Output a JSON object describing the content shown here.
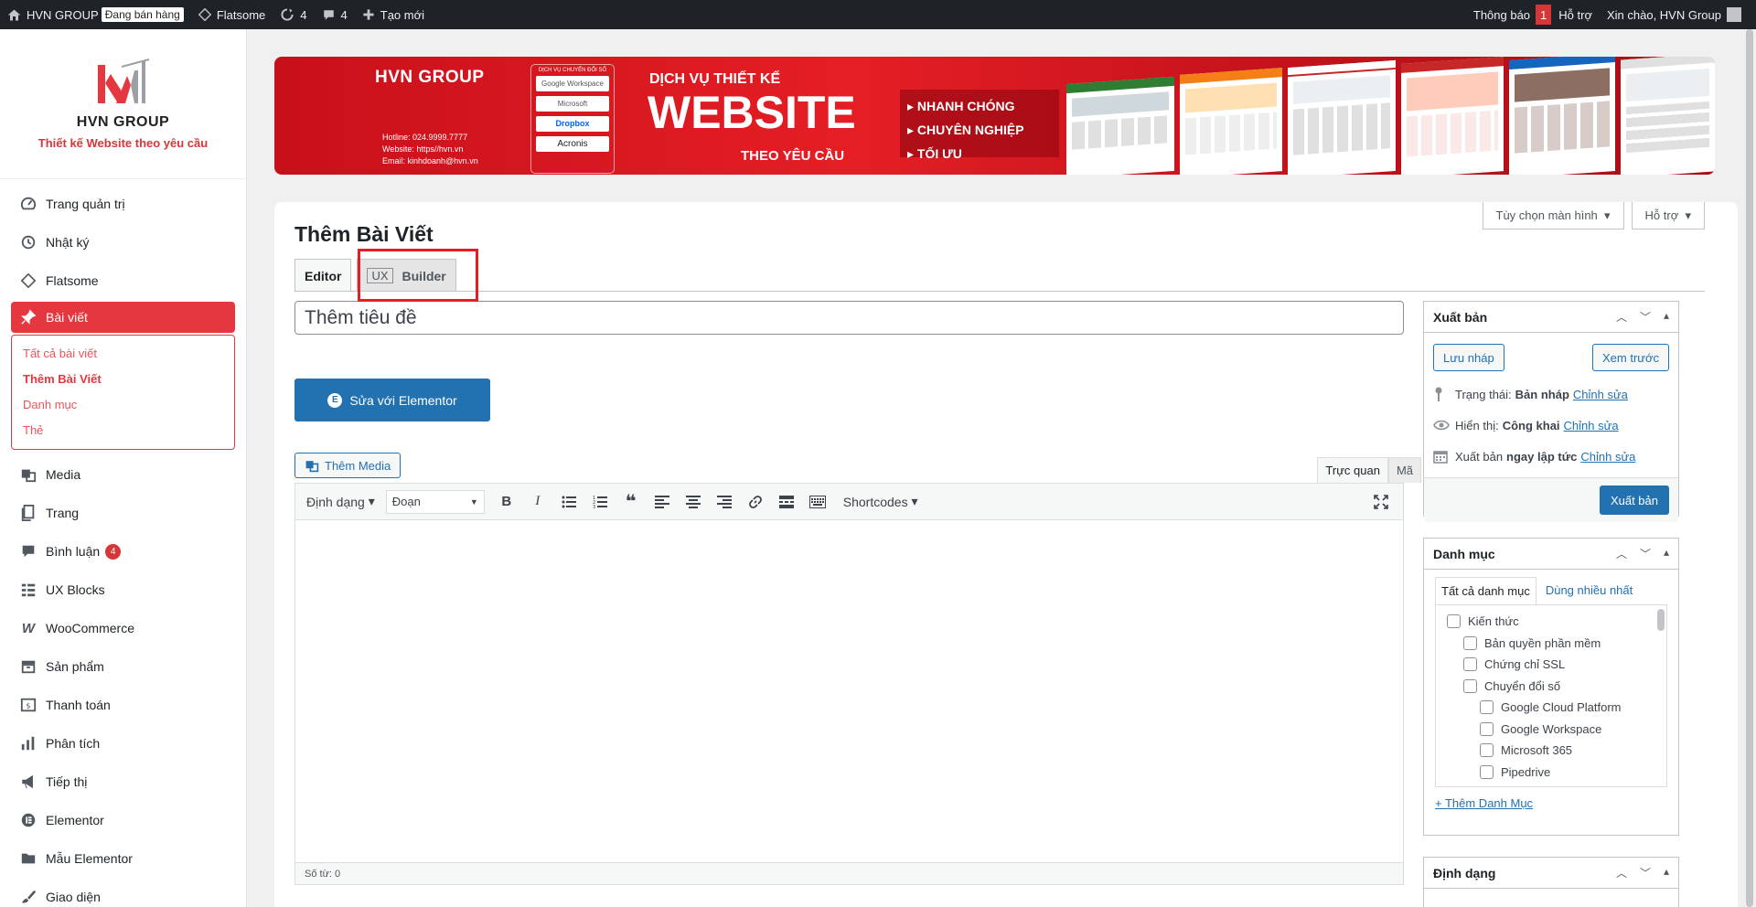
{
  "admin_bar": {
    "site_name": "HVN GROUP",
    "status_badge": "Đang bán hàng",
    "theme": "Flatsome",
    "updates": "4",
    "comments": "4",
    "new": "Tạo mới",
    "notifications": "Thông báo",
    "notifications_count": "1",
    "help": "Hỗ trợ",
    "greeting": "Xin chào, HVN Group"
  },
  "sidebar": {
    "logo_name": "HVN GROUP",
    "logo_tagline": "Thiết kế Website theo yêu cầu",
    "items": [
      {
        "label": "Trang quản trị",
        "icon": "dashboard-icon"
      },
      {
        "label": "Nhật ký",
        "icon": "history-icon"
      },
      {
        "label": "Flatsome",
        "icon": "flatsome-icon"
      },
      {
        "label": "Bài viết",
        "icon": "pin-icon",
        "active": true
      },
      {
        "label": "Media",
        "icon": "media-icon"
      },
      {
        "label": "Trang",
        "icon": "page-icon"
      },
      {
        "label": "Bình luận",
        "icon": "comment-icon",
        "count": "4"
      },
      {
        "label": "UX Blocks",
        "icon": "blocks-icon"
      },
      {
        "label": "WooCommerce",
        "icon": "woo-icon"
      },
      {
        "label": "Sản phẩm",
        "icon": "archive-icon"
      },
      {
        "label": "Thanh toán",
        "icon": "payment-icon"
      },
      {
        "label": "Phân tích",
        "icon": "chart-icon"
      },
      {
        "label": "Tiếp thị",
        "icon": "megaphone-icon"
      },
      {
        "label": "Elementor",
        "icon": "elementor-icon"
      },
      {
        "label": "Mẫu Elementor",
        "icon": "folder-icon"
      },
      {
        "label": "Giao diện",
        "icon": "brush-icon"
      }
    ],
    "submenu": [
      "Tất cả bài viết",
      "Thêm Bài Viết",
      "Danh mục",
      "Thẻ"
    ]
  },
  "banner": {
    "brand": "HVN GROUP",
    "hotline": "Hotline: 024.9999.7777",
    "website": "Website: https//hvn.vn",
    "email": "Email: kinhdoanh@hvn.vn",
    "partners_title": "DỊCH VỤ CHUYỂN ĐỔI SỐ",
    "partners": [
      "Google Workspace",
      "Microsoft",
      "Dropbox",
      "Acronis"
    ],
    "headline_small": "DỊCH VỤ THIẾT KẾ",
    "headline_big": "WEBSITE",
    "headline_sub": "THEO YÊU CẦU",
    "bullets": [
      "NHANH CHÓNG",
      "CHUYÊN NGHIỆP",
      "TỐI ƯU"
    ]
  },
  "main": {
    "screen_options": "Tùy chọn màn hình",
    "help": "Hỗ trợ",
    "page_title": "Thêm Bài Viết",
    "tab_editor": "Editor",
    "tab_ux": "UX",
    "tab_builder": "Builder",
    "title_placeholder": "Thêm tiêu đề",
    "elementor_button": "Sửa với Elementor",
    "add_media": "Thêm Media",
    "mode_visual": "Trực quan",
    "mode_code": "Mã",
    "format_menu": "Định dạng",
    "paragraph_select": "Đoạn",
    "shortcodes": "Shortcodes",
    "word_count": "Số từ: 0"
  },
  "publish_box": {
    "title": "Xuất bản",
    "save_draft": "Lưu nháp",
    "preview": "Xem trước",
    "status_label": "Trạng thái:",
    "status_value": "Bản nháp",
    "visibility_label": "Hiển thị:",
    "visibility_value": "Công khai",
    "publish_label": "Xuất bản",
    "publish_value": "ngay lập tức",
    "edit": "Chỉnh sửa",
    "publish_button": "Xuất bản"
  },
  "category_box": {
    "title": "Danh mục",
    "tab_all": "Tất cả danh mục",
    "tab_popular": "Dùng nhiều nhất",
    "categories": [
      {
        "label": "Kiến thức",
        "level": 0
      },
      {
        "label": "Bản quyền phần mềm",
        "level": 1
      },
      {
        "label": "Chứng chỉ SSL",
        "level": 1
      },
      {
        "label": "Chuyển đổi số",
        "level": 1
      },
      {
        "label": "Google Cloud Platform",
        "level": 2
      },
      {
        "label": "Google Workspace",
        "level": 2
      },
      {
        "label": "Microsoft 365",
        "level": 2
      },
      {
        "label": "Pipedrive",
        "level": 2
      }
    ],
    "add_new": "+ Thêm Danh Mục"
  },
  "format_box": {
    "title": "Định dạng"
  },
  "colors": {
    "accent": "#e5373f",
    "wp_blue": "#2271b1",
    "admin_bar": "#1d2327"
  }
}
